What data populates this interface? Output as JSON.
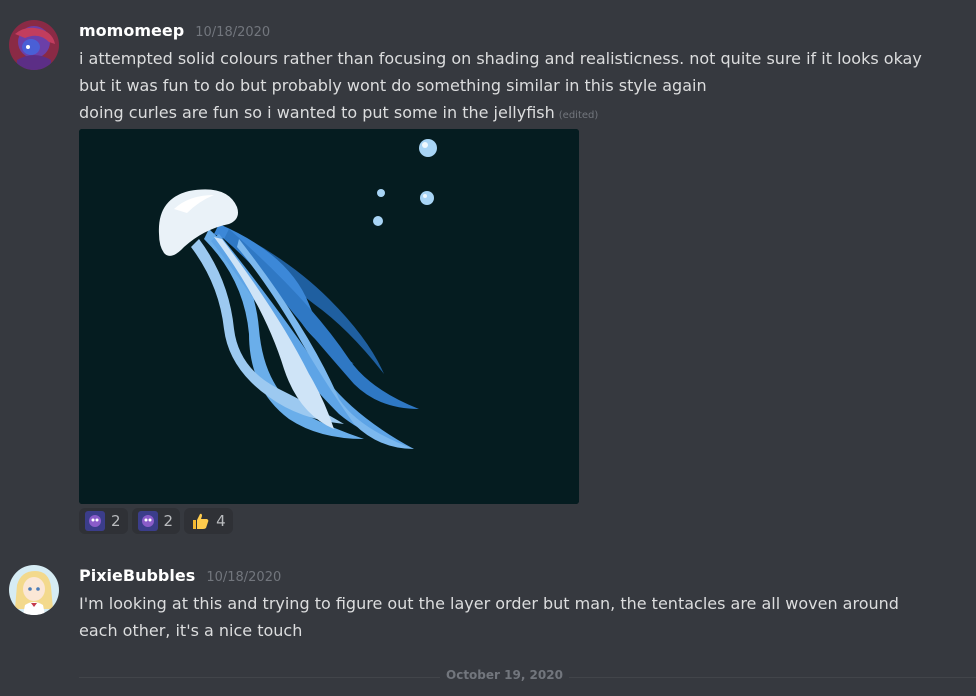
{
  "messages": [
    {
      "username": "momomeep",
      "timestamp": "10/18/2020",
      "lines": [
        "i attempted solid colours rather than focusing on shading and realisticness. not quite sure if it looks okay",
        "but it was fun to do but probably wont do something similar in this style again",
        "doing curles are fun so i wanted to put some in the jellyfish"
      ],
      "edited_label": "(edited)",
      "attachment_icon": "jellyfish-artwork",
      "reactions": [
        {
          "icon": "custom-emoji-purple",
          "count": "2"
        },
        {
          "icon": "custom-emoji-purple",
          "count": "2"
        },
        {
          "icon": "thumbs-up-emoji",
          "count": "4"
        }
      ]
    },
    {
      "username": "PixieBubbles",
      "timestamp": "10/18/2020",
      "lines": [
        "I'm looking at this and trying to figure out the layer order but man, the tentacles are all woven around",
        "each other, it's a nice touch"
      ]
    }
  ],
  "date_divider": "October 19, 2020",
  "colors": {
    "background": "#36393f",
    "username": "#ffffff",
    "text": "#dcddde",
    "muted": "#72767d",
    "reaction_bg": "#2f3136",
    "attachment_bg": "#051c20"
  }
}
